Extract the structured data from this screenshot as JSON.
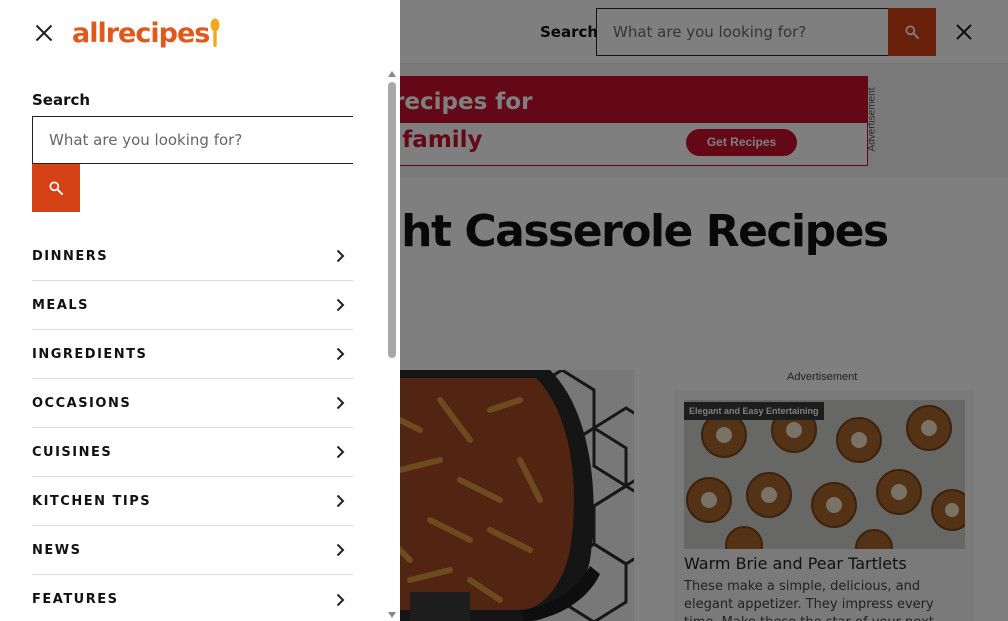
{
  "background": {
    "header": {
      "search_label": "Search",
      "search_placeholder": "What are you looking for?"
    },
    "banner": {
      "line1": "us recipes for",
      "line2": "ole family",
      "button": "Get Recipes",
      "ad_label": "Advertisement"
    },
    "page_title": "knight Casserole Recipes",
    "sidebar_ad": {
      "label": "Advertisement",
      "tag": "Elegant and Easy Entertaining",
      "title": "Warm Brie and Pear Tartlets",
      "description": "These make a simple, delicious, and elegant appetizer. They impress every time. Make these the star of your next entertainment spread!"
    },
    "colors": {
      "accent": "#d54215",
      "banner_red": "#c8102e",
      "logo_orange": "#e0591c"
    }
  },
  "drawer": {
    "logo": "allrecipes",
    "search": {
      "label": "Search",
      "placeholder": "What are you looking for?"
    },
    "nav": [
      {
        "label": "DINNERS"
      },
      {
        "label": "MEALS"
      },
      {
        "label": "INGREDIENTS"
      },
      {
        "label": "OCCASIONS"
      },
      {
        "label": "CUISINES"
      },
      {
        "label": "KITCHEN TIPS"
      },
      {
        "label": "NEWS"
      },
      {
        "label": "FEATURES"
      }
    ]
  }
}
